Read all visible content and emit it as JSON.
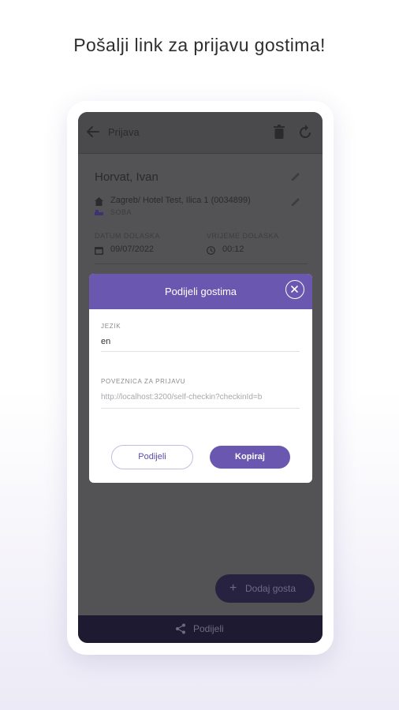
{
  "headline": "Pošalji link za prijavu gostima!",
  "colors": {
    "accent": "#6a58b0",
    "overlay_screen": "#535356",
    "fab_bg": "#27223f",
    "bottom_bar_bg": "#1d1a31"
  },
  "appbar": {
    "title": "Prijava",
    "icons": [
      "arrow-left-icon",
      "trash-icon",
      "refresh-icon"
    ]
  },
  "reservation": {
    "guest_name": "Horvat, Ivan",
    "hotel": "Zagreb/ Hotel Test, Ilica 1 (0034899)",
    "room_label": "SOBA",
    "arrival_date_label": "DATUM DOLASKA",
    "arrival_date": "09/07/2022",
    "arrival_time_label": "VRIJEME DOLASKA",
    "arrival_time": "00:12"
  },
  "fab": {
    "plus": "+",
    "label": "Dodaj gosta"
  },
  "bottom_bar": {
    "label": "Podijeli"
  },
  "dialog": {
    "title": "Podijeli gostima",
    "language_label": "JEZIK",
    "language_value": "en",
    "link_label": "POVEZNICA ZA PRIJAVU",
    "link_value": "http://localhost:3200/self-checkin?checkinId=b",
    "share_button": "Podijeli",
    "copy_button": "Kopiraj"
  }
}
